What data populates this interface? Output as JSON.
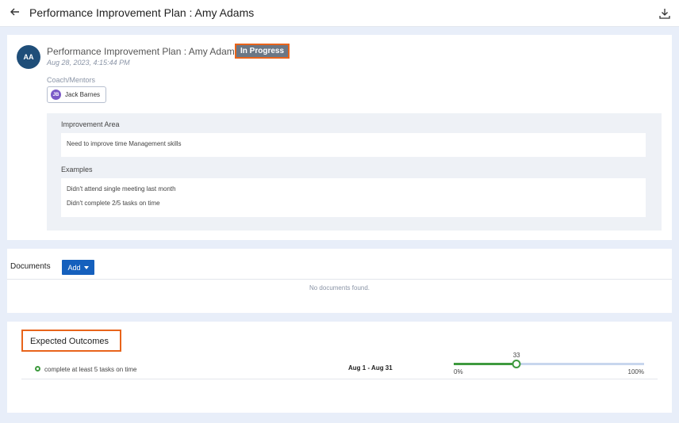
{
  "header": {
    "title": "Performance Improvement Plan : Amy Adams",
    "back_icon": "arrow-left-icon",
    "download_icon": "download-icon"
  },
  "plan": {
    "avatar_initials": "AA",
    "title": "Performance Improvement Plan : Amy Adams",
    "status": "In Progress",
    "date": "Aug 28, 2023, 4:15:44 PM",
    "coach_label": "Coach/Mentors",
    "coach": {
      "initials": "JB",
      "name": "Jack Barnes"
    },
    "improvement_area_label": "Improvement Area",
    "improvement_area": "Need to improve time Management skills",
    "examples_label": "Examples",
    "examples": [
      "Didn't attend single meeting last month",
      "Didn't complete 2/5 tasks on time"
    ]
  },
  "documents": {
    "label": "Documents",
    "add_label": "Add",
    "empty_text": "No documents found."
  },
  "outcomes": {
    "heading": "Expected Outcomes",
    "items": [
      {
        "text": "complete at least 5 tasks on time",
        "dates": "Aug 1 - Aug 31",
        "progress": 33,
        "min_label": "0%",
        "max_label": "100%"
      }
    ]
  },
  "colors": {
    "accent": "#1560bd",
    "highlight_border": "#e8641b",
    "progress_green": "#3e9a3e",
    "avatar_blue": "#1f4e79",
    "chip_purple": "#7a59c7"
  }
}
